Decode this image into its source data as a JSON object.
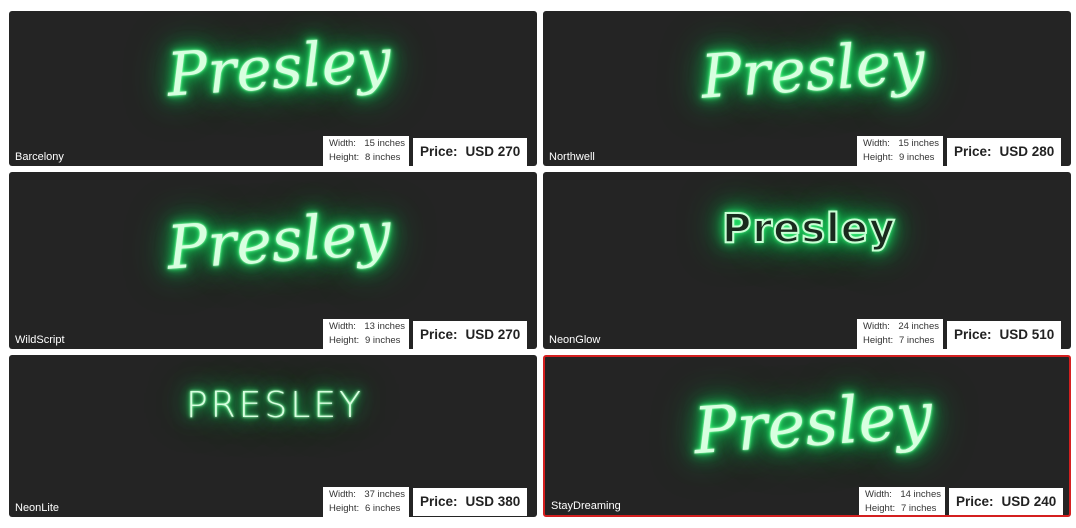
{
  "products": [
    {
      "font": "Barcelony",
      "text": "Presley",
      "style": "script",
      "width_label": "Width:",
      "width": "15 inches",
      "height_label": "Height:",
      "height": "8 inches",
      "price_label": "Price:",
      "price": "USD 270",
      "selected": false
    },
    {
      "font": "Northwell",
      "text": "Presley",
      "style": "script",
      "width_label": "Width:",
      "width": "15 inches",
      "height_label": "Height:",
      "height": "9 inches",
      "price_label": "Price:",
      "price": "USD 280",
      "selected": false
    },
    {
      "font": "WildScript",
      "text": "Presley",
      "style": "script",
      "width_label": "Width:",
      "width": "13 inches",
      "height_label": "Height:",
      "height": "9 inches",
      "price_label": "Price:",
      "price": "USD 270",
      "selected": false
    },
    {
      "font": "NeonGlow",
      "text": "Presley",
      "style": "glow",
      "width_label": "Width:",
      "width": "24 inches",
      "height_label": "Height:",
      "height": "7 inches",
      "price_label": "Price:",
      "price": "USD 510",
      "selected": false
    },
    {
      "font": "NeonLite",
      "text": "PRESLEY",
      "style": "lite",
      "width_label": "Width:",
      "width": "37 inches",
      "height_label": "Height:",
      "height": "6 inches",
      "price_label": "Price:",
      "price": "USD 380",
      "selected": false
    },
    {
      "font": "StayDreaming",
      "text": "Presley",
      "style": "script",
      "width_label": "Width:",
      "width": "14 inches",
      "height_label": "Height:",
      "height": "7 inches",
      "price_label": "Price:",
      "price": "USD 240",
      "selected": true
    }
  ],
  "colors": {
    "card_bg": "#242424",
    "neon_green": "#1fe86a",
    "selected_border": "#d41f1f"
  }
}
